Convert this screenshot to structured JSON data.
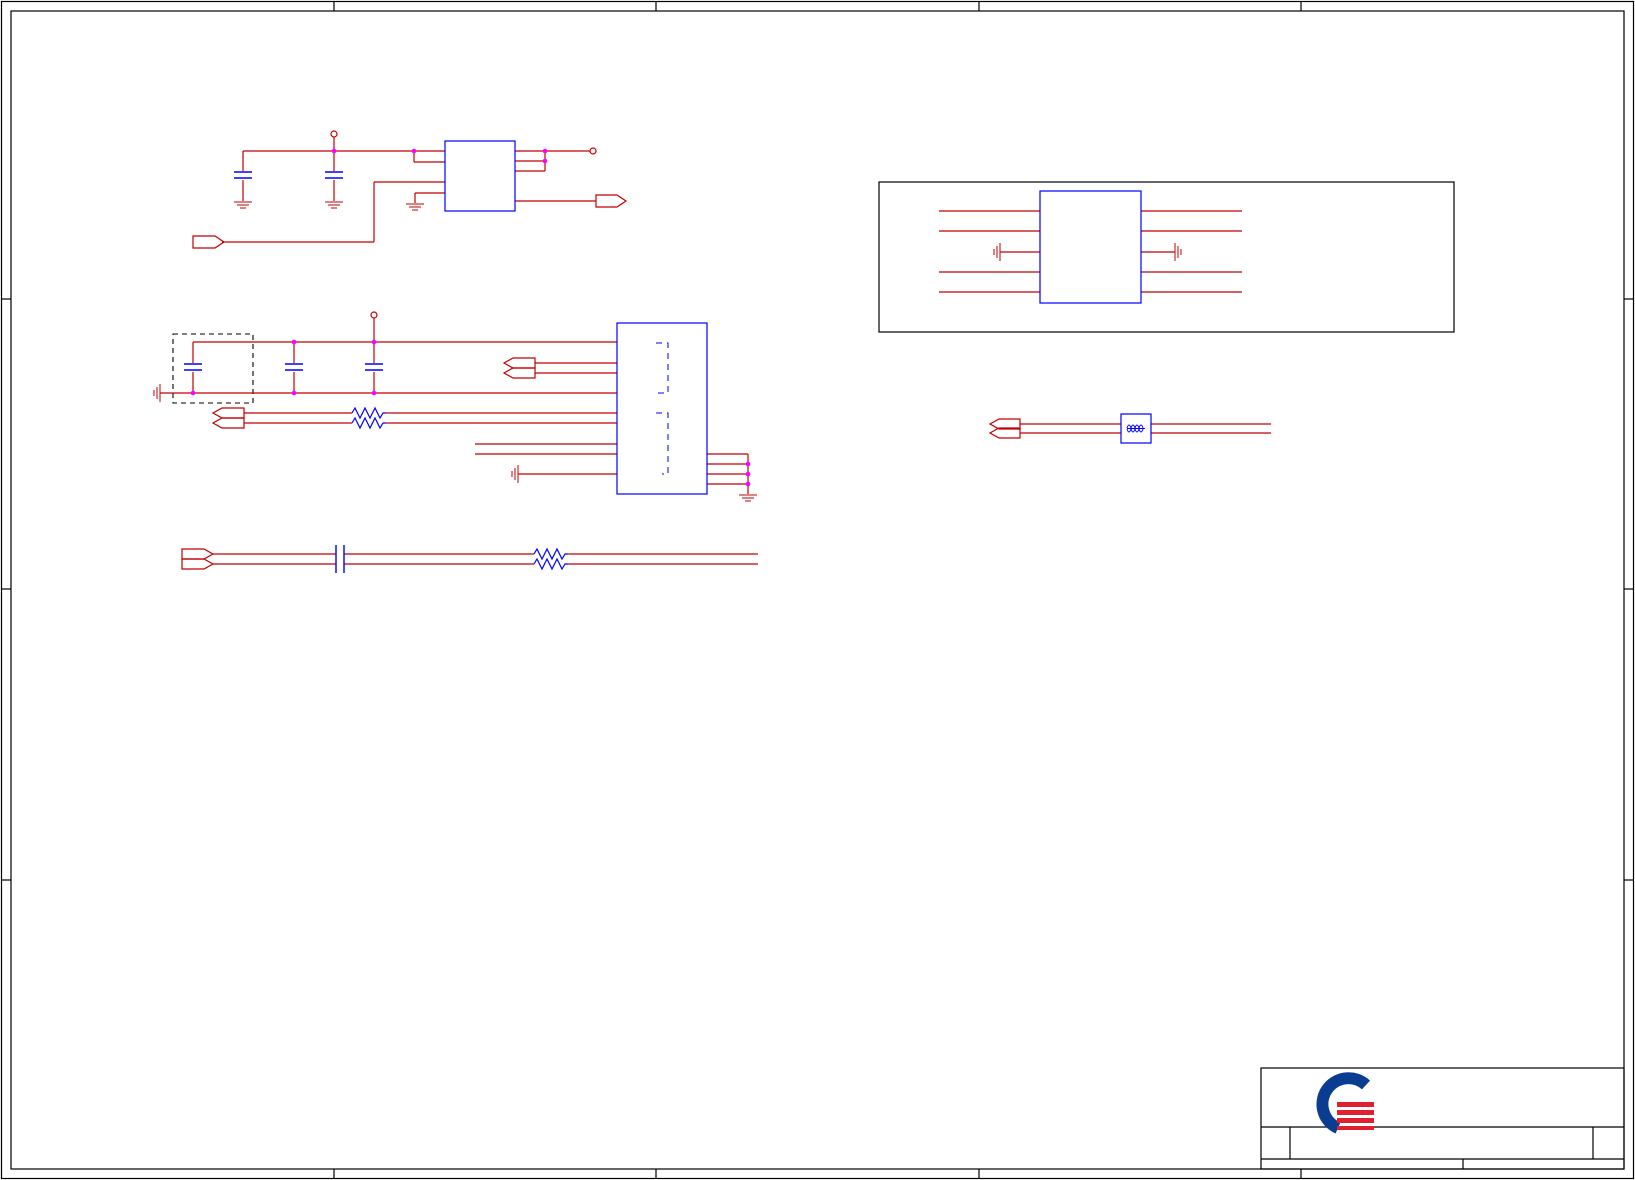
{
  "drawing": {
    "colors": {
      "background": "#ffffff",
      "frame": "#000000",
      "wire": "#c00000",
      "component": "#0000ff",
      "junction": "#ff00ff",
      "dashed_box": "#000000",
      "logo_blue": "#0a3d91",
      "logo_red": "#e0202e"
    },
    "title_block": {
      "logo": "company-logo"
    }
  }
}
